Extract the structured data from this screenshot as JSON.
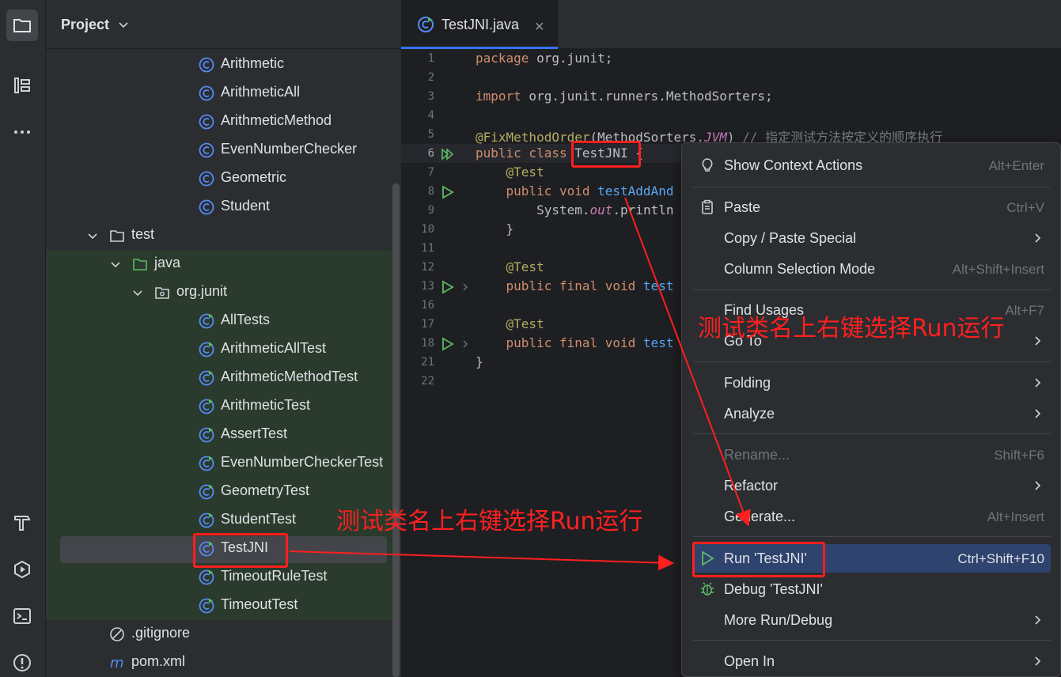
{
  "project_panel": {
    "title": "Project",
    "tree": [
      {
        "label": "Arithmetic",
        "kind": "class"
      },
      {
        "label": "ArithmeticAll",
        "kind": "class"
      },
      {
        "label": "ArithmeticMethod",
        "kind": "class"
      },
      {
        "label": "EvenNumberChecker",
        "kind": "class"
      },
      {
        "label": "Geometric",
        "kind": "class"
      },
      {
        "label": "Student",
        "kind": "class"
      },
      {
        "label": "test",
        "kind": "folder"
      },
      {
        "label": "java",
        "kind": "source-folder"
      },
      {
        "label": "org.junit",
        "kind": "package"
      },
      {
        "label": "AllTests",
        "kind": "test-class"
      },
      {
        "label": "ArithmeticAllTest",
        "kind": "test-class"
      },
      {
        "label": "ArithmeticMethodTest",
        "kind": "test-class"
      },
      {
        "label": "ArithmeticTest",
        "kind": "test-class"
      },
      {
        "label": "AssertTest",
        "kind": "test-class"
      },
      {
        "label": "EvenNumberCheckerTest",
        "kind": "test-class"
      },
      {
        "label": "GeometryTest",
        "kind": "test-class"
      },
      {
        "label": "StudentTest",
        "kind": "test-class"
      },
      {
        "label": "TestJNI",
        "kind": "test-class",
        "selected": true
      },
      {
        "label": "TimeoutRuleTest",
        "kind": "test-class"
      },
      {
        "label": "TimeoutTest",
        "kind": "test-class"
      },
      {
        "label": ".gitignore",
        "kind": "ignore-file"
      },
      {
        "label": "pom.xml",
        "kind": "maven-file"
      }
    ]
  },
  "editor": {
    "tab_label": "TestJNI.java",
    "line_numbers": [
      "1",
      "2",
      "3",
      "4",
      "5",
      "6",
      "7",
      "8",
      "9",
      "10",
      "11",
      "12",
      "13",
      "16",
      "17",
      "18",
      "21",
      "22"
    ],
    "code": {
      "l1_kw": "package",
      "l1_rest": " org.junit;",
      "l3_kw": "import",
      "l3_rest": " org.junit.runners.MethodSorters;",
      "l5_ann": "@FixMethodOrder",
      "l5_a": "(MethodSorters.",
      "l5_jvm": "JVM",
      "l5_b": ") ",
      "l5_comment": "// 指定测试方法按定义的顺序执行",
      "l6_kw": "public class ",
      "l6_name": "TestJNI",
      "l6_rest": " {",
      "l7_ann": "    @Test",
      "l8_kw": "    public void ",
      "l8_fn": "testAddAnd",
      "l9_a": "        System.",
      "l9_out": "out",
      "l9_b": ".println",
      "l10": "    }",
      "l12_ann": "    @Test",
      "l13_kw": "    public final void ",
      "l13_fn": "test",
      "l17_ann": "    @Test",
      "l18_kw": "    public final void ",
      "l18_fn": "test",
      "l21": "}"
    }
  },
  "context_menu": {
    "show_context_actions": {
      "label": "Show Context Actions",
      "shortcut": "Alt+Enter"
    },
    "paste": {
      "label": "Paste",
      "shortcut": "Ctrl+V"
    },
    "copy_paste_special": {
      "label": "Copy / Paste Special"
    },
    "column_selection": {
      "label": "Column Selection Mode",
      "shortcut": "Alt+Shift+Insert"
    },
    "find_usages": {
      "label": "Find Usages",
      "shortcut": "Alt+F7"
    },
    "go_to": {
      "label": "Go To"
    },
    "folding": {
      "label": "Folding"
    },
    "analyze": {
      "label": "Analyze"
    },
    "rename": {
      "label": "Rename...",
      "shortcut": "Shift+F6"
    },
    "refactor": {
      "label": "Refactor"
    },
    "generate": {
      "label": "Generate...",
      "shortcut": "Alt+Insert"
    },
    "run": {
      "label": "Run 'TestJNI'",
      "shortcut": "Ctrl+Shift+F10"
    },
    "debug": {
      "label": "Debug 'TestJNI'"
    },
    "more_run_debug": {
      "label": "More Run/Debug"
    },
    "open_in": {
      "label": "Open In"
    }
  },
  "annotations": {
    "note_left": "测试类名上右键选择Run运行",
    "note_right": "测试类名上右键选择Run运行"
  },
  "colors": {
    "accent": "#3574f0",
    "annotation_red": "#ff1f1f",
    "menu_highlight": "#2e436e",
    "run_green": "#5fb865"
  }
}
